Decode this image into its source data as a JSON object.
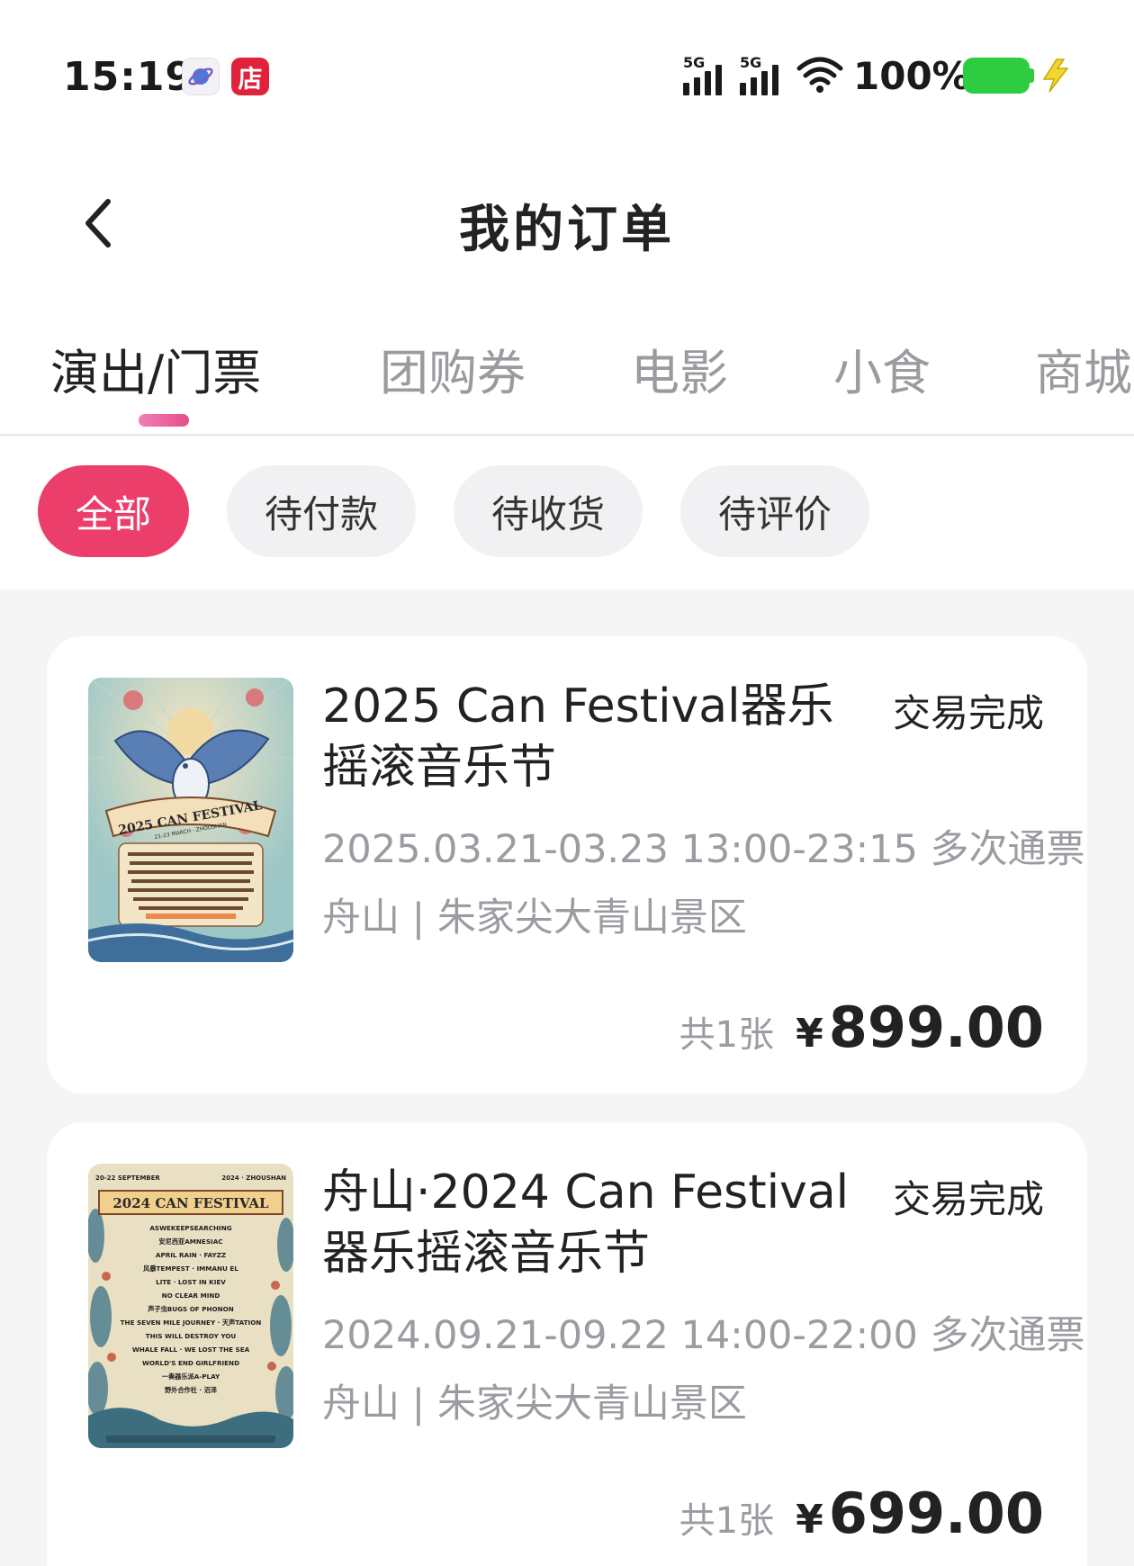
{
  "status_bar": {
    "time": "15:19",
    "shop_icon_text": "店",
    "signal_1_label": "5G",
    "signal_2_label": "5G",
    "battery_text": "100%",
    "battery_color": "#2ecc40"
  },
  "nav": {
    "title": "我的订单"
  },
  "tabs": [
    {
      "label": "演出/门票",
      "active": true
    },
    {
      "label": "团购券",
      "active": false
    },
    {
      "label": "电影",
      "active": false
    },
    {
      "label": "小食",
      "active": false
    },
    {
      "label": "商城",
      "active": false
    }
  ],
  "filters": [
    {
      "label": "全部",
      "active": true
    },
    {
      "label": "待付款",
      "active": false
    },
    {
      "label": "待收货",
      "active": false
    },
    {
      "label": "待评价",
      "active": false
    }
  ],
  "accent_color": "#ec3e6a",
  "orders": [
    {
      "title": "2025 Can Festival器乐摇滚音乐节",
      "status": "交易完成",
      "time": "2025.03.21-03.23 13:00-23:15 多次通票",
      "venue": "舟山 | 朱家尖大青山景区",
      "ticket_count": "共1张",
      "currency": "¥",
      "price": "899.00",
      "poster": {
        "banner_line_1": "2025 CAN FESTIVAL",
        "banner_line_2": "21-23 MARCH · ZHOUSHAN"
      }
    },
    {
      "title": "舟山·2024 Can Festival器乐摇滚音乐节",
      "status": "交易完成",
      "time": "2024.09.21-09.22 14:00-22:00 多次通票",
      "venue": "舟山 | 朱家尖大青山景区",
      "ticket_count": "共1张",
      "currency": "¥",
      "price": "699.00",
      "poster": {
        "header_left": "20-22 SEPTEMBER",
        "header_right": "2024 · ZHOUSHAN",
        "banner": "2024 CAN FESTIVAL",
        "lineup": [
          "ASWEKEEPSEARCHING",
          "安尼西亚AMNESIAC",
          "APRIL RAIN · FAYZZ",
          "风暴TEMPEST · IMMANU EL",
          "LITE · LOST IN KIEV",
          "NO CLEAR MIND",
          "声子虫BUGS OF PHONON",
          "THE SEVEN MILE JOURNEY · 天声TATION",
          "THIS WILL DESTROY YOU",
          "WHALE FALL · WE LOST THE SEA",
          "WORLD'S END GIRLFRIEND",
          "一奏器乐派A-PLAY",
          "野外合作社 · 沼泽"
        ]
      }
    }
  ]
}
